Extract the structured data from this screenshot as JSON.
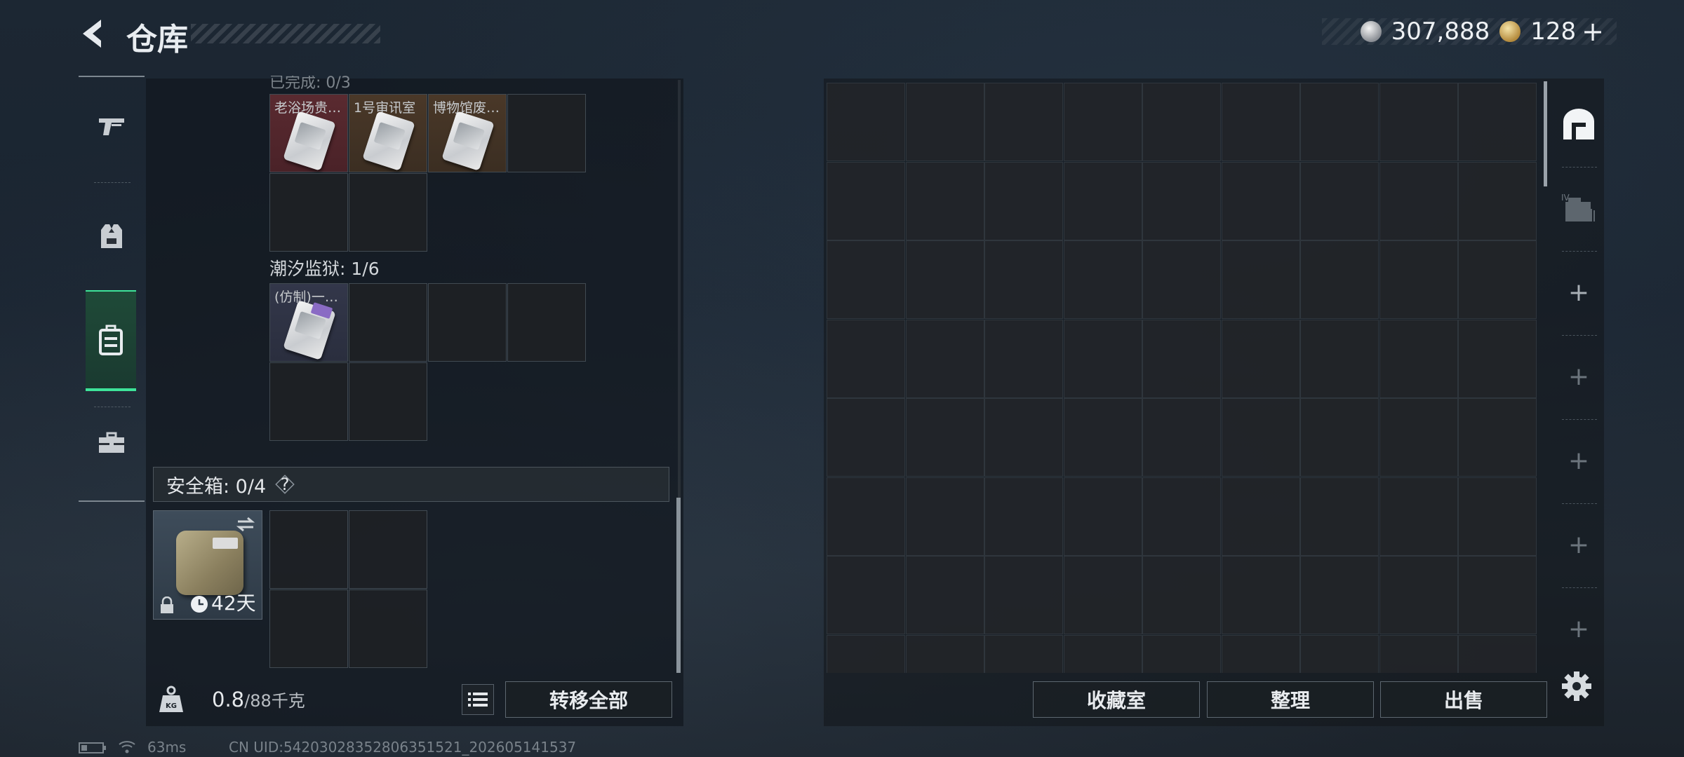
{
  "header": {
    "title": "仓库",
    "currencies": [
      {
        "icon": "silver-coin-icon",
        "value": "307,888"
      },
      {
        "icon": "gold-coin-icon",
        "value": "128"
      }
    ],
    "add_label": "+"
  },
  "categories": [
    {
      "icon": "pistol-icon",
      "active": false
    },
    {
      "icon": "armor-vest-icon",
      "active": false
    },
    {
      "icon": "backpack-icon",
      "active": true
    },
    {
      "icon": "toolbox-icon",
      "active": false
    }
  ],
  "left": {
    "cut_section_label": "已完成: 0/3",
    "key_items": [
      {
        "name": "老浴场贵…",
        "rarity": "red"
      },
      {
        "name": "1号审讯室",
        "rarity": "brown"
      },
      {
        "name": "博物馆废…",
        "rarity": "brown"
      }
    ],
    "prison_section": {
      "label": "潮汐监狱: 1/6",
      "items": [
        {
          "name": "(仿制)一…",
          "rarity": "slate"
        }
      ]
    },
    "safe": {
      "title": "安全箱: 0/4",
      "help": "?",
      "days": "42天"
    },
    "weight": {
      "current": "0.8",
      "max": "/88千克"
    },
    "transfer_all_label": "转移全部"
  },
  "right": {
    "buttons": {
      "collection": "收藏室",
      "sort": "整理",
      "sell": "出售"
    },
    "tabs": [
      {
        "icon": "storage-home-icon"
      },
      {
        "icon": "folder-stack-icon"
      },
      {
        "label": "+"
      },
      {
        "label": "+"
      },
      {
        "label": "+"
      },
      {
        "label": "+"
      },
      {
        "label": "+"
      }
    ]
  },
  "status": {
    "ping": "63ms",
    "uid": "CN UID:5420302835280635152​1_202605141537"
  },
  "colors": {
    "accent": "#3ee49a",
    "red_rarity": "#5a2a30",
    "brown_rarity": "#4a3828"
  }
}
